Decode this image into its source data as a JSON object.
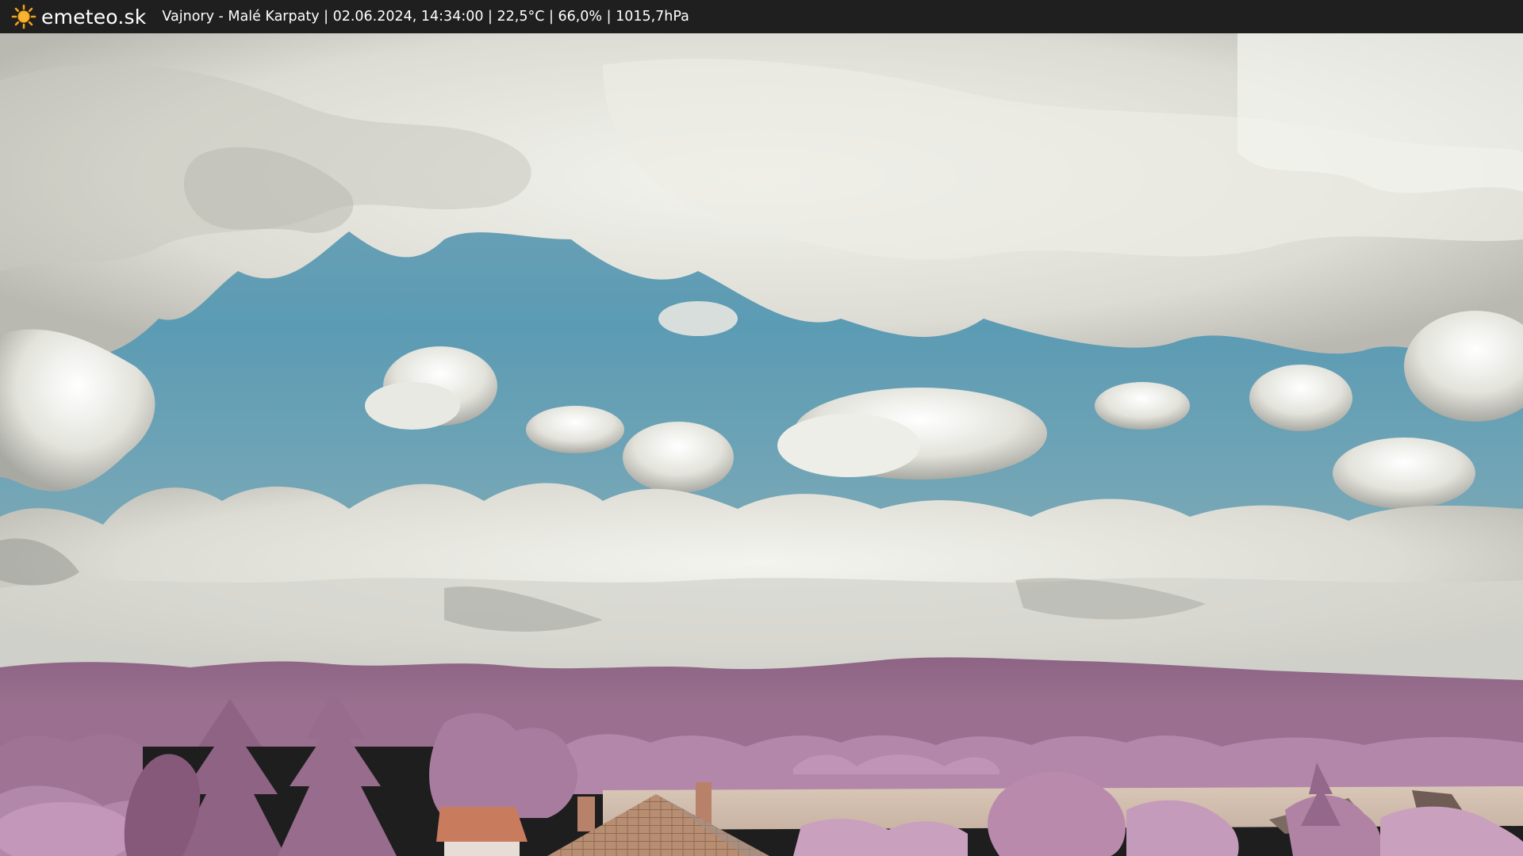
{
  "header": {
    "brand": "emeteo.sk",
    "brand_icon": "sun-icon",
    "caption": "Vajnory - Malé Karpaty | 02.06.2024, 14:34:00 | 22,5°C | 66,0% | 1015,7hPa"
  },
  "colors": {
    "bar_background": "#1f1f1f",
    "sun_accent": "#f2a21a",
    "sky": "#5d9cb5",
    "cloud": "#e6e6df",
    "foliage": "#b184a6",
    "roof": "#c97a5a"
  }
}
